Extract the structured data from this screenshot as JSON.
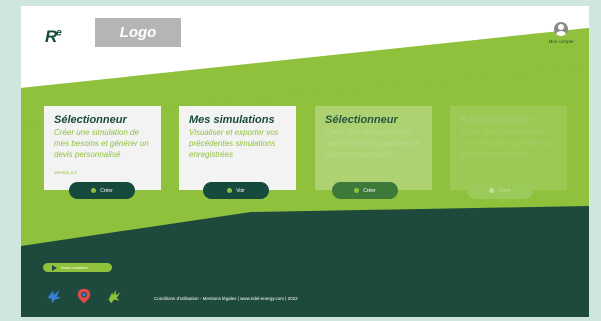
{
  "header": {
    "brand_mark": "R",
    "brand_sup": "e",
    "logo_text": "Logo",
    "account_label": "Mon compte"
  },
  "cards": [
    {
      "title": "Sélectionneur",
      "description": "Créer une simulation de mes besoins et générer un devis personnalisé",
      "version": "Version 2.2",
      "button": "Créer"
    },
    {
      "title": "Mes simulations",
      "description": "Visualiser et exporter vos précédentes simulations enregistrées",
      "button": "Voir"
    },
    {
      "title": "Sélectionneur",
      "description": "Créer une simulation de mes besoins et générer un devis personnalisé",
      "button": "Créer"
    },
    {
      "title": "Sélectionneur",
      "description": "Créer une simulation de mes besoins et générer un devis personnalisé",
      "button": "Créer"
    }
  ],
  "footer": {
    "contact_button": "Nous contacter",
    "legal_text": "Conditions d'utilisation - Mentions légales | www.ridel-energy.com | 2022",
    "icons": [
      "blue-bird-icon",
      "map-pin-icon",
      "green-bird-icon"
    ]
  },
  "colors": {
    "dark_green": "#164a3c",
    "light_green": "#8fc13c",
    "header_white": "#ffffff",
    "logo_gray": "#b5b5b5"
  }
}
